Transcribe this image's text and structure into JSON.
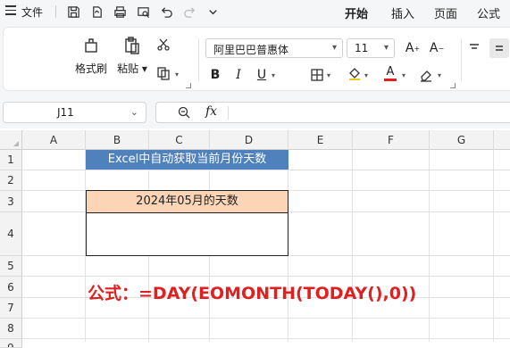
{
  "menubar": {
    "file_label": "文件",
    "tabs": [
      {
        "label": "开始",
        "active": true
      },
      {
        "label": "插入",
        "active": false
      },
      {
        "label": "页面",
        "active": false
      },
      {
        "label": "公式",
        "active": false
      }
    ]
  },
  "ribbon": {
    "format_painter": "格式刷",
    "paste": "粘贴",
    "font_name": "阿里巴巴普惠体",
    "font_size": "11"
  },
  "formula_bar": {
    "cell_ref": "J11",
    "fx_label": "fx",
    "formula": ""
  },
  "sheet": {
    "columns": [
      "A",
      "B",
      "C",
      "D",
      "E",
      "F",
      "G"
    ],
    "rows": [
      "1",
      "2",
      "3",
      "4",
      "5",
      "6",
      "7",
      "8",
      "9"
    ],
    "title_cell": "Excel中自动获取当前月份天数",
    "header_cell": "2024年05月的天数",
    "result_cell": "",
    "formula_note": "公式：=DAY(EOMONTH(TODAY(),0))"
  },
  "colors": {
    "title_fill": "#4f81bd",
    "header_fill": "#fbd5b5",
    "formula_note_color": "#e02020",
    "accent": "#1f6feb",
    "font_color_swatch": "#e02020"
  }
}
